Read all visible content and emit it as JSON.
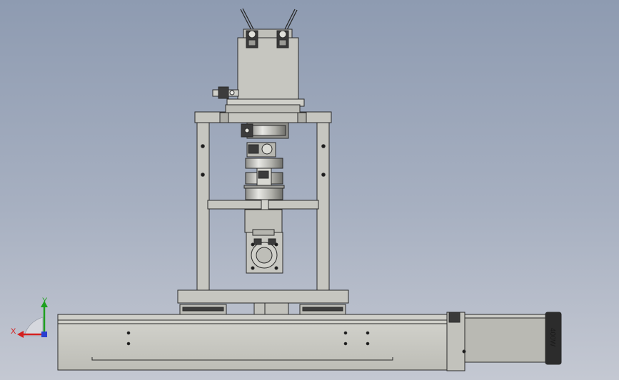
{
  "model": {
    "motor_label": "400W"
  },
  "triad": {
    "x_label": "X",
    "y_label": "Y",
    "x_color": "#d42020",
    "y_color": "#1ea01e",
    "z_color": "#2a3fd0"
  },
  "colors": {
    "part_fill": "#c6c6c0",
    "part_stroke": "#2a2a2a",
    "motor_fill": "#b8b8b2",
    "endcap_fill": "#2c2c2c"
  }
}
